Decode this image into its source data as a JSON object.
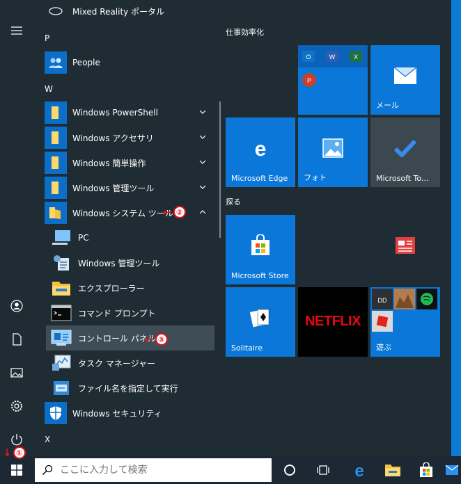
{
  "app_list": {
    "partial_top": "Mixed Reality ポータル",
    "letter_p": "P",
    "people": "People",
    "letter_w": "W",
    "powershell": "Windows PowerShell",
    "accessories": "Windows アクセサリ",
    "ease": "Windows 簡単操作",
    "admin_tools": "Windows 管理ツール",
    "system_tools": "Windows システム ツール",
    "pc": "PC",
    "sub_admin_tools": "Windows 管理ツール",
    "explorer": "エクスプローラー",
    "cmd": "コマンド プロンプト",
    "control_panel": "コントロール パネル",
    "task_manager": "タスク マネージャー",
    "run": "ファイル名を指定して実行",
    "security": "Windows セキュリティ",
    "letter_x": "X"
  },
  "annotations": {
    "one": "①",
    "two": "②",
    "three": "③"
  },
  "tiles": {
    "group1_title": "仕事効率化",
    "mail": "メール",
    "edge": "Microsoft Edge",
    "photos": "フォト",
    "todo": "Microsoft To...",
    "group2_title": "探る",
    "store": "Microsoft Store",
    "solitaire": "Solitaire",
    "netflix": "NETFLIX",
    "play": "遊ぶ"
  },
  "taskbar": {
    "search_placeholder": "ここに入力して検索"
  },
  "colors": {
    "accent": "#0b77d8",
    "menu_bg": "#1f2c34",
    "annotation": "#e3121b",
    "netflix_red": "#e50914"
  }
}
